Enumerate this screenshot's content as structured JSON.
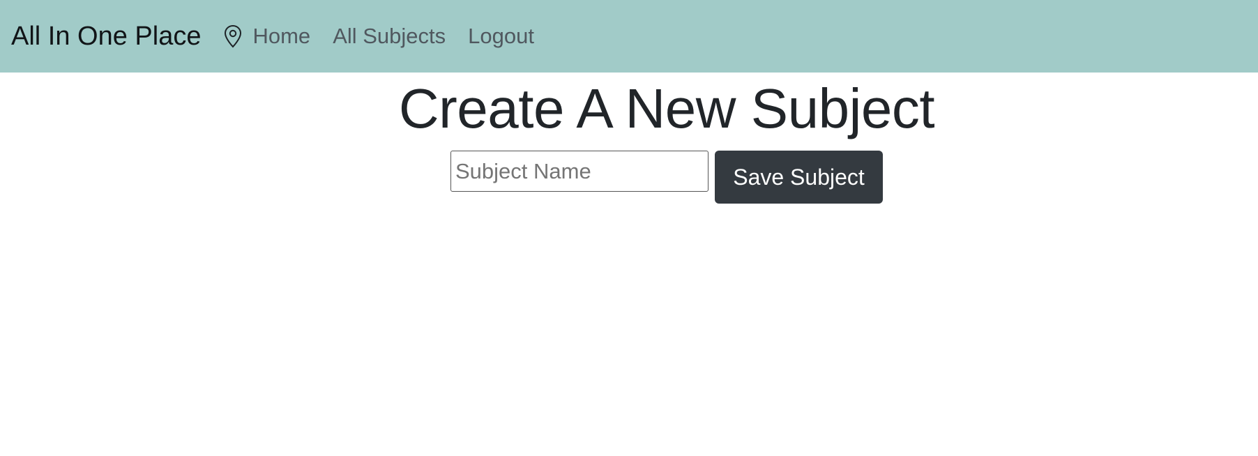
{
  "navbar": {
    "brand": "All In One Place",
    "icon": "map-pin-icon",
    "links": [
      {
        "label": "Home"
      },
      {
        "label": "All Subjects"
      },
      {
        "label": "Logout"
      }
    ],
    "background_color": "#a1cbc8"
  },
  "main": {
    "title": "Create A New Subject",
    "subject_input": {
      "value": "",
      "placeholder": "Subject Name"
    },
    "save_label": "Save Subject",
    "save_button_color": "#343a40"
  }
}
